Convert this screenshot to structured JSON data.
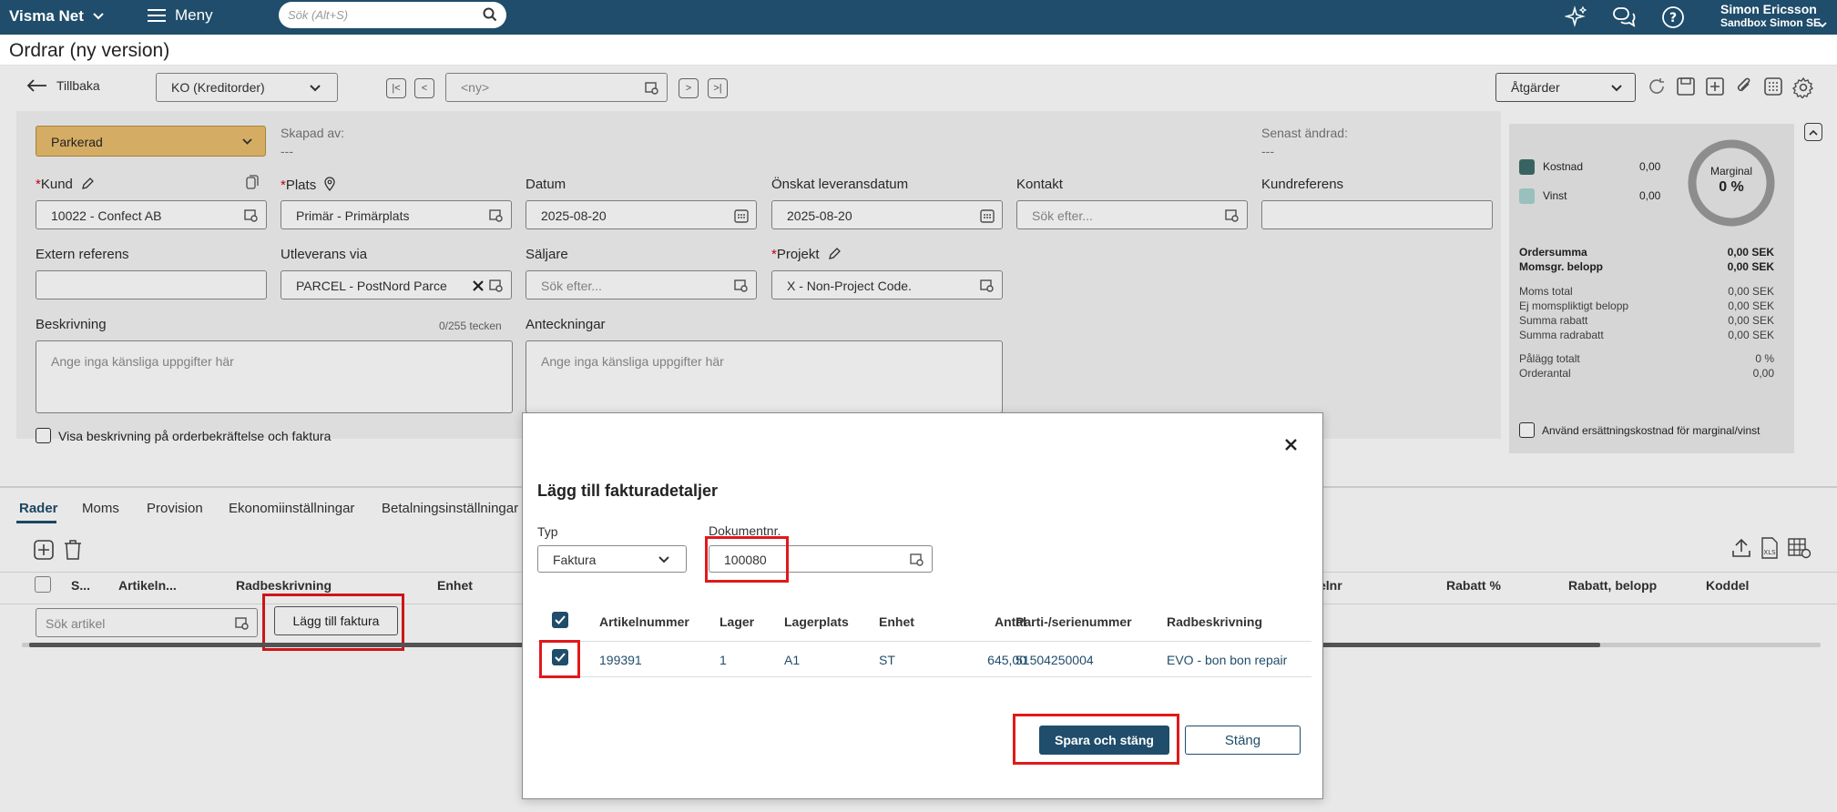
{
  "topbar": {
    "brand": "Visma Net",
    "menu_label": "Meny",
    "search_placeholder": "Sök (Alt+S)",
    "user_name": "Simon Ericsson",
    "user_company": "Sandbox Simon SE"
  },
  "page": {
    "title": "Ordrar (ny version)"
  },
  "toolbar": {
    "back_label": "Tillbaka",
    "order_type": "KO (Kreditorder)",
    "order_nr_placeholder": "<ny>",
    "actions_label": "Åtgärder"
  },
  "form": {
    "status": "Parkerad",
    "created_by_label": "Skapad av:",
    "created_by_value": "---",
    "last_changed_label": "Senast ändrad:",
    "last_changed_value": "---",
    "kund_label": "Kund",
    "kund_value": "10022 - Confect AB",
    "plats_label": "Plats",
    "plats_value": "Primär - Primärplats",
    "datum_label": "Datum",
    "datum_value": "2025-08-20",
    "leverans_label": "Önskat leveransdatum",
    "leverans_value": "2025-08-20",
    "kontakt_label": "Kontakt",
    "kontakt_placeholder": "Sök efter...",
    "kundref_label": "Kundreferens",
    "extref_label": "Extern referens",
    "utleverans_label": "Utleverans via",
    "utleverans_value": "PARCEL - PostNord Parce",
    "saljare_label": "Säljare",
    "saljare_placeholder": "Sök efter...",
    "projekt_label": "Projekt",
    "projekt_value": "X - Non-Project Code.",
    "beskrivning_label": "Beskrivning",
    "beskrivning_counter": "0/255 tecken",
    "beskrivning_placeholder": "Ange inga känsliga uppgifter här",
    "anteckningar_label": "Anteckningar",
    "anteckningar_placeholder": "Ange inga känsliga uppgifter här",
    "visa_beskrivning_label": "Visa beskrivning på orderbekräftelse och faktura"
  },
  "summary": {
    "legend_kostnad": "Kostnad",
    "legend_kostnad_value": "0,00",
    "legend_vinst": "Vinst",
    "legend_vinst_value": "0,00",
    "donut_label": "Marginal",
    "donut_value": "0 %",
    "rows": [
      {
        "label": "Ordersumma",
        "value": "0,00 SEK"
      },
      {
        "label": "Momsgr. belopp",
        "value": "0,00 SEK"
      },
      {
        "label": "Moms total",
        "value": "0,00 SEK"
      },
      {
        "label": "Ej momspliktigt belopp",
        "value": "0,00 SEK"
      },
      {
        "label": "Summa rabatt",
        "value": "0,00 SEK"
      },
      {
        "label": "Summa radrabatt",
        "value": "0,00 SEK"
      },
      {
        "label": "Pålägg totalt",
        "value": "0 %"
      },
      {
        "label": "Orderantal",
        "value": "0,00"
      }
    ],
    "ersattning_label": "Använd ersättningskostnad för marginal/vinst",
    "colors": {
      "kostnad": "#3d6e6b",
      "vinst": "#a9d3cf",
      "donut": "#9b9b9b"
    }
  },
  "tabs": [
    "Rader",
    "Moms",
    "Provision",
    "Ekonomiinställningar",
    "Betalningsinställningar"
  ],
  "grid": {
    "columns": [
      "S...",
      "Artikeln...",
      "Radbeskrivning",
      "Enhet",
      "elnr",
      "Rabatt %",
      "Rabatt, belopp",
      "Koddel"
    ],
    "search_placeholder": "Sök artikel",
    "add_invoice_label": "Lägg till faktura"
  },
  "modal": {
    "title": "Lägg till fakturadetaljer",
    "typ_label": "Typ",
    "typ_value": "Faktura",
    "doknr_label": "Dokumentnr.",
    "doknr_value": "100080",
    "columns": [
      "Artikelnummer",
      "Lager",
      "Lagerplats",
      "Enhet",
      "Antal",
      "Parti-/serienummer",
      "Radbeskrivning"
    ],
    "row": {
      "artikelnummer": "199391",
      "lager": "1",
      "lagerplats": "A1",
      "enhet": "ST",
      "antal": "645,00",
      "parti": "51504250004",
      "radbeskrivning": "EVO - bon bon repair"
    },
    "save_label": "Spara och stäng",
    "close_label": "Stäng"
  },
  "colors": {
    "primary": "#1f4d6b",
    "status_bg": "#e9be6e",
    "highlight": "#e0191b"
  }
}
